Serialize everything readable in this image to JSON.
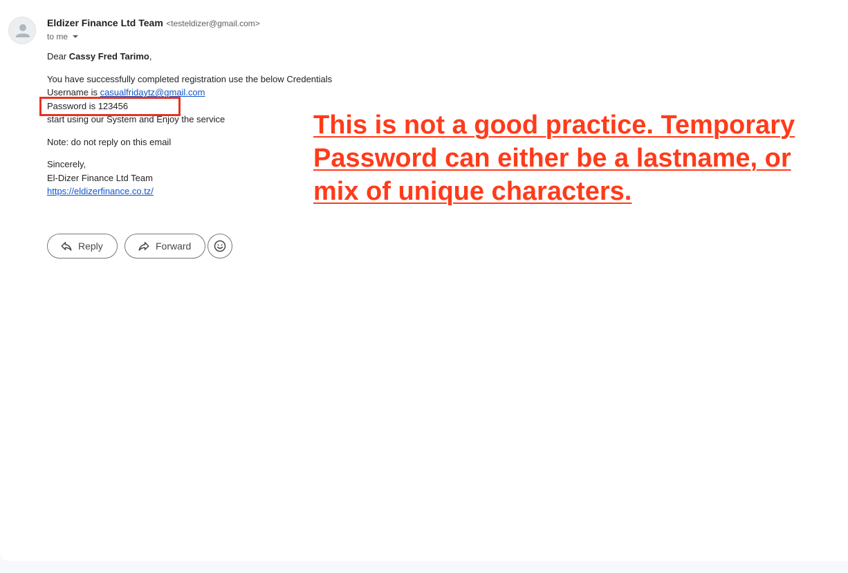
{
  "email": {
    "sender_name": "Eldizer Finance Ltd Team",
    "sender_email": "<testeldizer@gmail.com>",
    "recipient_label": "to me",
    "greeting_prefix": "Dear ",
    "greeting_name": "Cassy Fred Tarimo",
    "greeting_suffix": ",",
    "line_intro": "You have successfully completed registration use the below Credentials",
    "username_prefix": "Username is ",
    "username_link": "casualfridaytz@gmail.com",
    "password_line": "Password is 123456",
    "start_line": "start using our System and Enjoy the service",
    "note_line": "Note: do not reply on this email",
    "sign_off": "Sincerely,",
    "signature_name": "El-Dizer Finance Ltd Team",
    "website_link": "https://eldizerfinance.co.tz/"
  },
  "annotation": {
    "text": "This is not a good practice. Temporary Password can either be a lastname, or mix of unique characters.",
    "color": "#ff3b1a"
  },
  "actions": {
    "reply_label": "Reply",
    "forward_label": "Forward",
    "reply_icon": "reply-arrow-icon",
    "forward_icon": "forward-arrow-icon",
    "emoji_icon": "smiley-icon"
  }
}
